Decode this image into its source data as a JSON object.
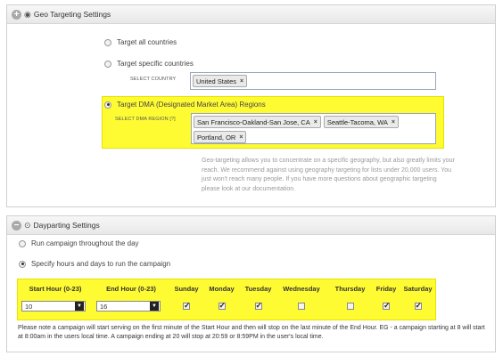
{
  "geo": {
    "title": "Geo Targeting Settings",
    "toggle": "+",
    "option_all": "Target all countries",
    "option_specific": "Target specific countries",
    "select_country_label": "SELECT COUNTRY",
    "countries": [
      "United States"
    ],
    "option_dma": "Target DMA (Designated Market Area) Regions",
    "select_dma_label": "SELECT DMA REGION",
    "dma_help_link": "[?]",
    "dma_regions": [
      "San Francisco-Oakland-San Jose, CA",
      "Seattle-Tacoma, WA",
      "Portland, OR"
    ],
    "remove_glyph": "×",
    "help_text": "Geo-targeting allows you to concentrate on a specific geography, but also greatly limits your reach. We recommend against using geography targeting for lists under 20,000 users. You just won't reach many people. If you have more questions about geographic targeting please look at our documentation.",
    "selected_option": "dma"
  },
  "daypart": {
    "title": "Dayparting Settings",
    "toggle": "−",
    "option_all_day": "Run campaign throughout the day",
    "option_specific": "Specify hours and days to run the campaign",
    "selected_option": "specific",
    "start_header": "Start Hour (0-23)",
    "end_header": "End Hour (0-23)",
    "start_value": "10",
    "end_value": "16",
    "days": [
      {
        "label": "Sunday",
        "checked": true
      },
      {
        "label": "Monday",
        "checked": true
      },
      {
        "label": "Tuesday",
        "checked": true
      },
      {
        "label": "Wednesday",
        "checked": false
      },
      {
        "label": "Thursday",
        "checked": false
      },
      {
        "label": "Friday",
        "checked": true
      },
      {
        "label": "Saturday",
        "checked": true
      }
    ],
    "note": "Please note a campaign will start serving on the first minute of the Start Hour and then will stop on the last minute of the End Hour. EG - a campaign starting at 8 will start at 8:00am in the users local time. A campaign ending at 20 will stop at 20:59 or 8:59PM in the user's local time."
  },
  "colors": {
    "highlight": "#fffb33",
    "tagbox_border": "#9aa6ba"
  }
}
